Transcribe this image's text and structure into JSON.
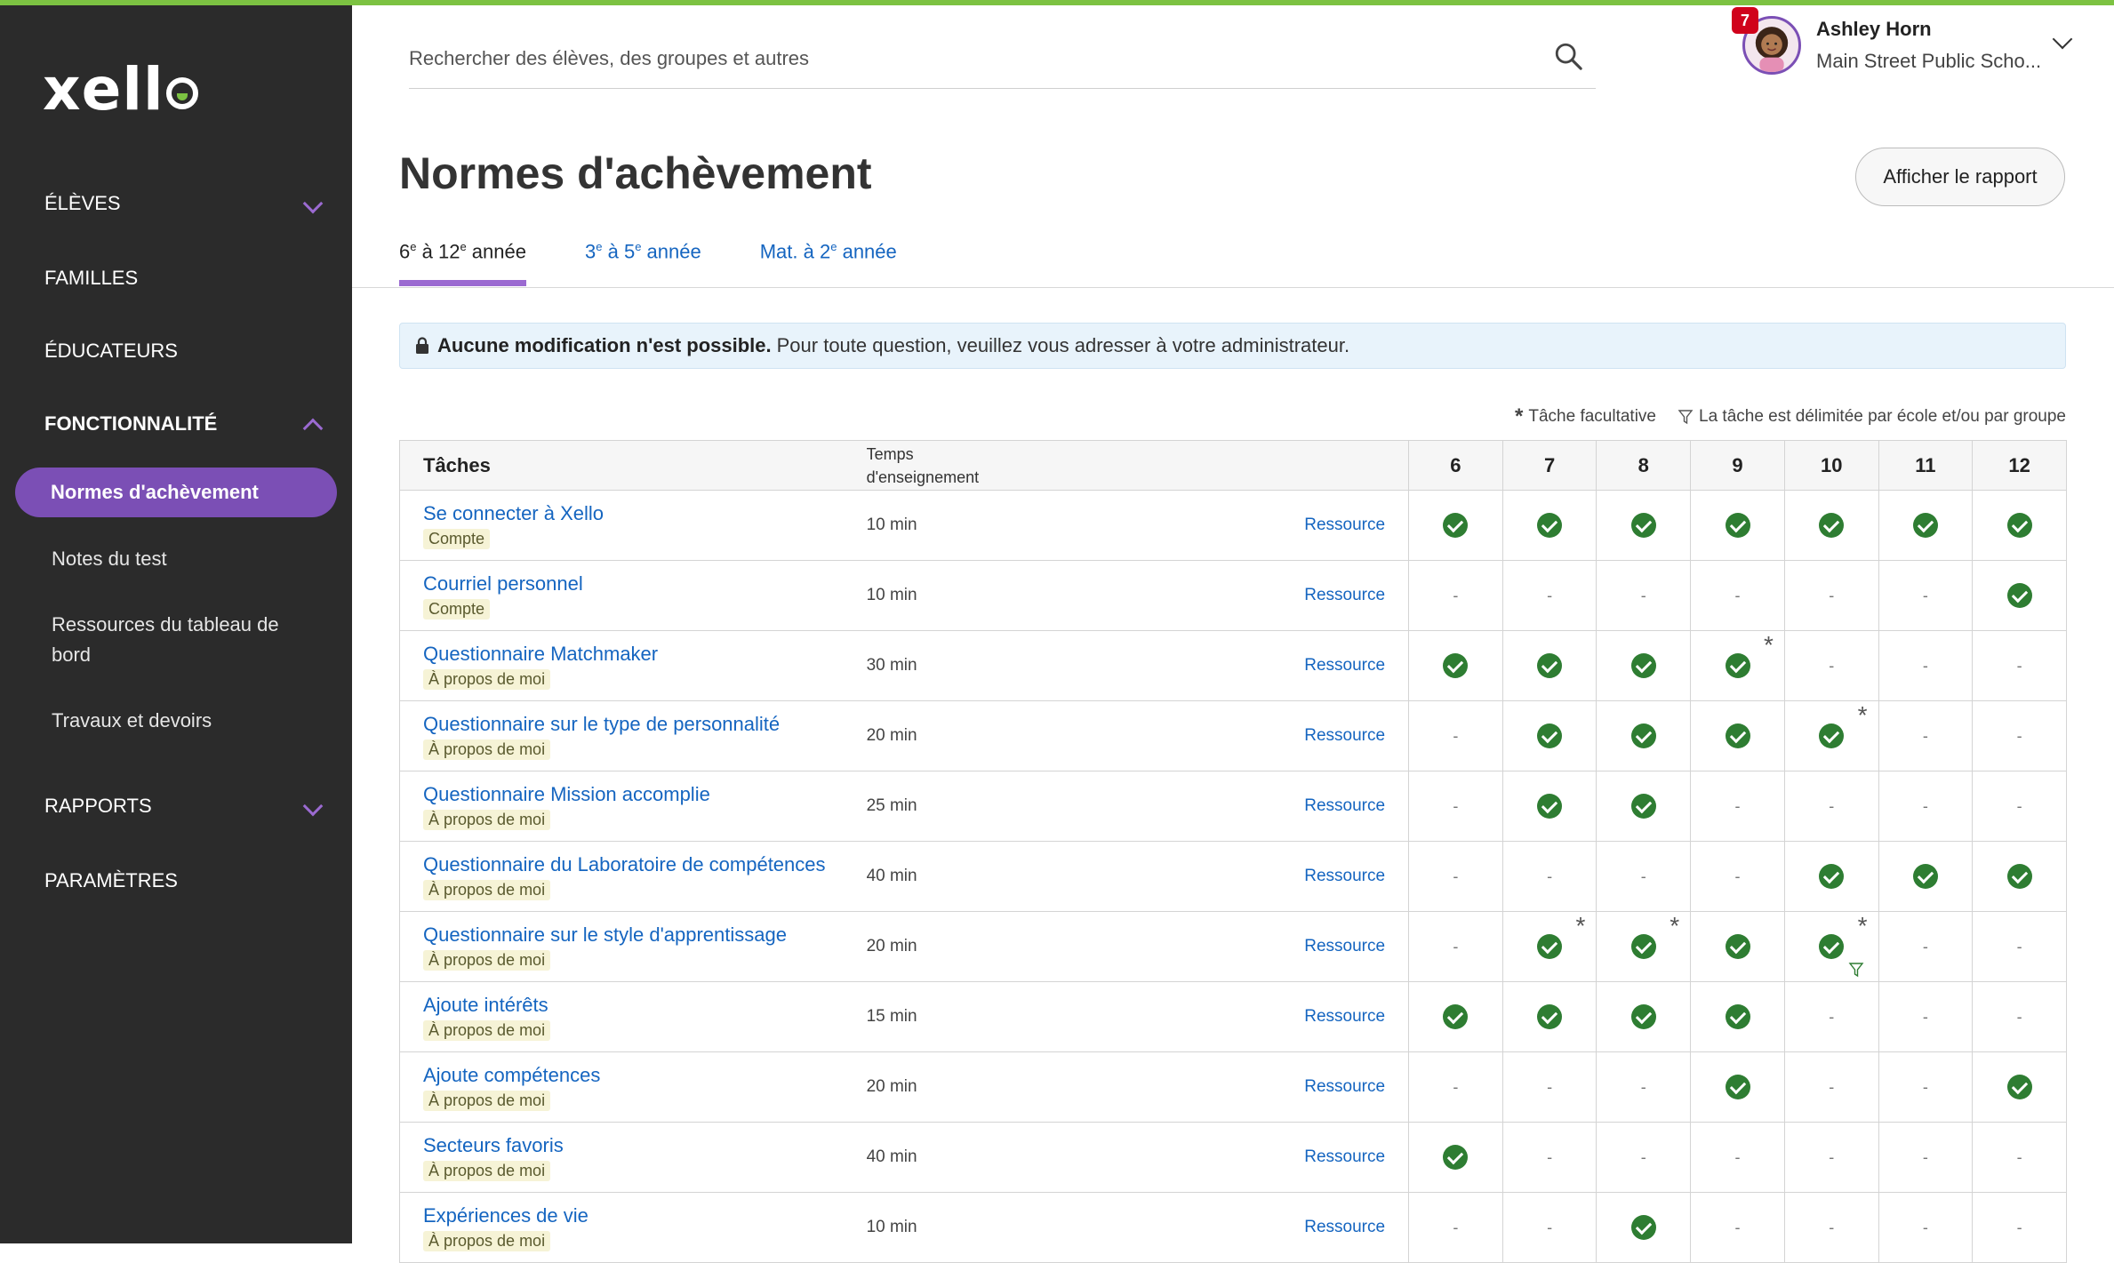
{
  "brand": {
    "logo_text": "xell",
    "accent": "#7cc242",
    "purple": "#7b4fb5"
  },
  "sidebar": {
    "items": [
      {
        "label": "ÉLÈVES"
      },
      {
        "label": "FAMILLES"
      },
      {
        "label": "ÉDUCATEURS"
      },
      {
        "label": "FONCTIONNALITÉ"
      },
      {
        "label": "RAPPORTS"
      },
      {
        "label": "PARAMÈTRES"
      }
    ],
    "sub_items": [
      {
        "label": "Normes d'achèvement"
      },
      {
        "label": "Notes du test"
      },
      {
        "label": "Ressources du tableau de bord"
      },
      {
        "label": "Travaux et devoirs"
      }
    ]
  },
  "search": {
    "placeholder": "Rechercher des élèves, des groupes et autres"
  },
  "user": {
    "badge": "7",
    "name": "Ashley Horn",
    "school": "Main Street Public Scho..."
  },
  "page": {
    "title": "Normes d'achèvement",
    "report_button": "Afficher le rapport",
    "tabs": [
      {
        "a": "6",
        "b": "à 12",
        "c": "année"
      },
      {
        "a": "3",
        "b": "à 5",
        "c": "année"
      },
      {
        "a": "Mat. à 2",
        "c": "année"
      }
    ],
    "tab_sup": "e",
    "notice_bold": "Aucune modification n'est possible.",
    "notice_text": "Pour toute question, veuillez vous adresser à votre administrateur.",
    "legend_optional": "Tâche facultative",
    "legend_scoped": "La tâche est délimitée par école et/ou par groupe"
  },
  "table": {
    "head_task": "Tâches",
    "head_time_1": "Temps",
    "head_time_2": "d'enseignement",
    "grades": [
      "6",
      "7",
      "8",
      "9",
      "10",
      "11",
      "12"
    ],
    "resource_label": "Ressource",
    "dash": "-",
    "rows": [
      {
        "task": "Se connecter à Xello",
        "tag": "Compte",
        "time": "10 min",
        "cells": [
          "c",
          "c",
          "c",
          "c",
          "c",
          "c",
          "c"
        ],
        "stars": [],
        "funnels": []
      },
      {
        "task": "Courriel personnel",
        "tag": "Compte",
        "time": "10 min",
        "cells": [
          "d",
          "d",
          "d",
          "d",
          "d",
          "d",
          "c"
        ],
        "stars": [],
        "funnels": []
      },
      {
        "task": "Questionnaire Matchmaker",
        "tag": "À propos de moi",
        "time": "30 min",
        "cells": [
          "c",
          "c",
          "c",
          "c",
          "d",
          "d",
          "d"
        ],
        "stars": [
          3
        ],
        "funnels": []
      },
      {
        "task": "Questionnaire sur le type de personnalité",
        "tag": "À propos de moi",
        "time": "20 min",
        "cells": [
          "d",
          "c",
          "c",
          "c",
          "c",
          "d",
          "d"
        ],
        "stars": [
          4
        ],
        "funnels": []
      },
      {
        "task": "Questionnaire Mission accomplie",
        "tag": "À propos de moi",
        "time": "25 min",
        "cells": [
          "d",
          "c",
          "c",
          "d",
          "d",
          "d",
          "d"
        ],
        "stars": [],
        "funnels": []
      },
      {
        "task": "Questionnaire du Laboratoire de compétences",
        "tag": "À propos de moi",
        "time": "40 min",
        "cells": [
          "d",
          "d",
          "d",
          "d",
          "c",
          "c",
          "c"
        ],
        "stars": [],
        "funnels": []
      },
      {
        "task": "Questionnaire sur le style d'apprentissage",
        "tag": "À propos de moi",
        "time": "20 min",
        "cells": [
          "d",
          "c",
          "c",
          "c",
          "c",
          "d",
          "d"
        ],
        "stars": [
          1,
          2,
          4
        ],
        "funnels": [
          4
        ]
      },
      {
        "task": "Ajoute intérêts",
        "tag": "À propos de moi",
        "time": "15 min",
        "cells": [
          "c",
          "c",
          "c",
          "c",
          "d",
          "d",
          "d"
        ],
        "stars": [],
        "funnels": []
      },
      {
        "task": "Ajoute compétences",
        "tag": "À propos de moi",
        "time": "20 min",
        "cells": [
          "d",
          "d",
          "d",
          "c",
          "d",
          "d",
          "c"
        ],
        "stars": [],
        "funnels": []
      },
      {
        "task": "Secteurs favoris",
        "tag": "À propos de moi",
        "time": "40 min",
        "cells": [
          "c",
          "d",
          "d",
          "d",
          "d",
          "d",
          "d"
        ],
        "stars": [],
        "funnels": []
      },
      {
        "task": "Expériences de vie",
        "tag": "À propos de moi",
        "time": "10 min",
        "cells": [
          "d",
          "d",
          "c",
          "d",
          "d",
          "d",
          "d"
        ],
        "stars": [],
        "funnels": []
      }
    ]
  }
}
